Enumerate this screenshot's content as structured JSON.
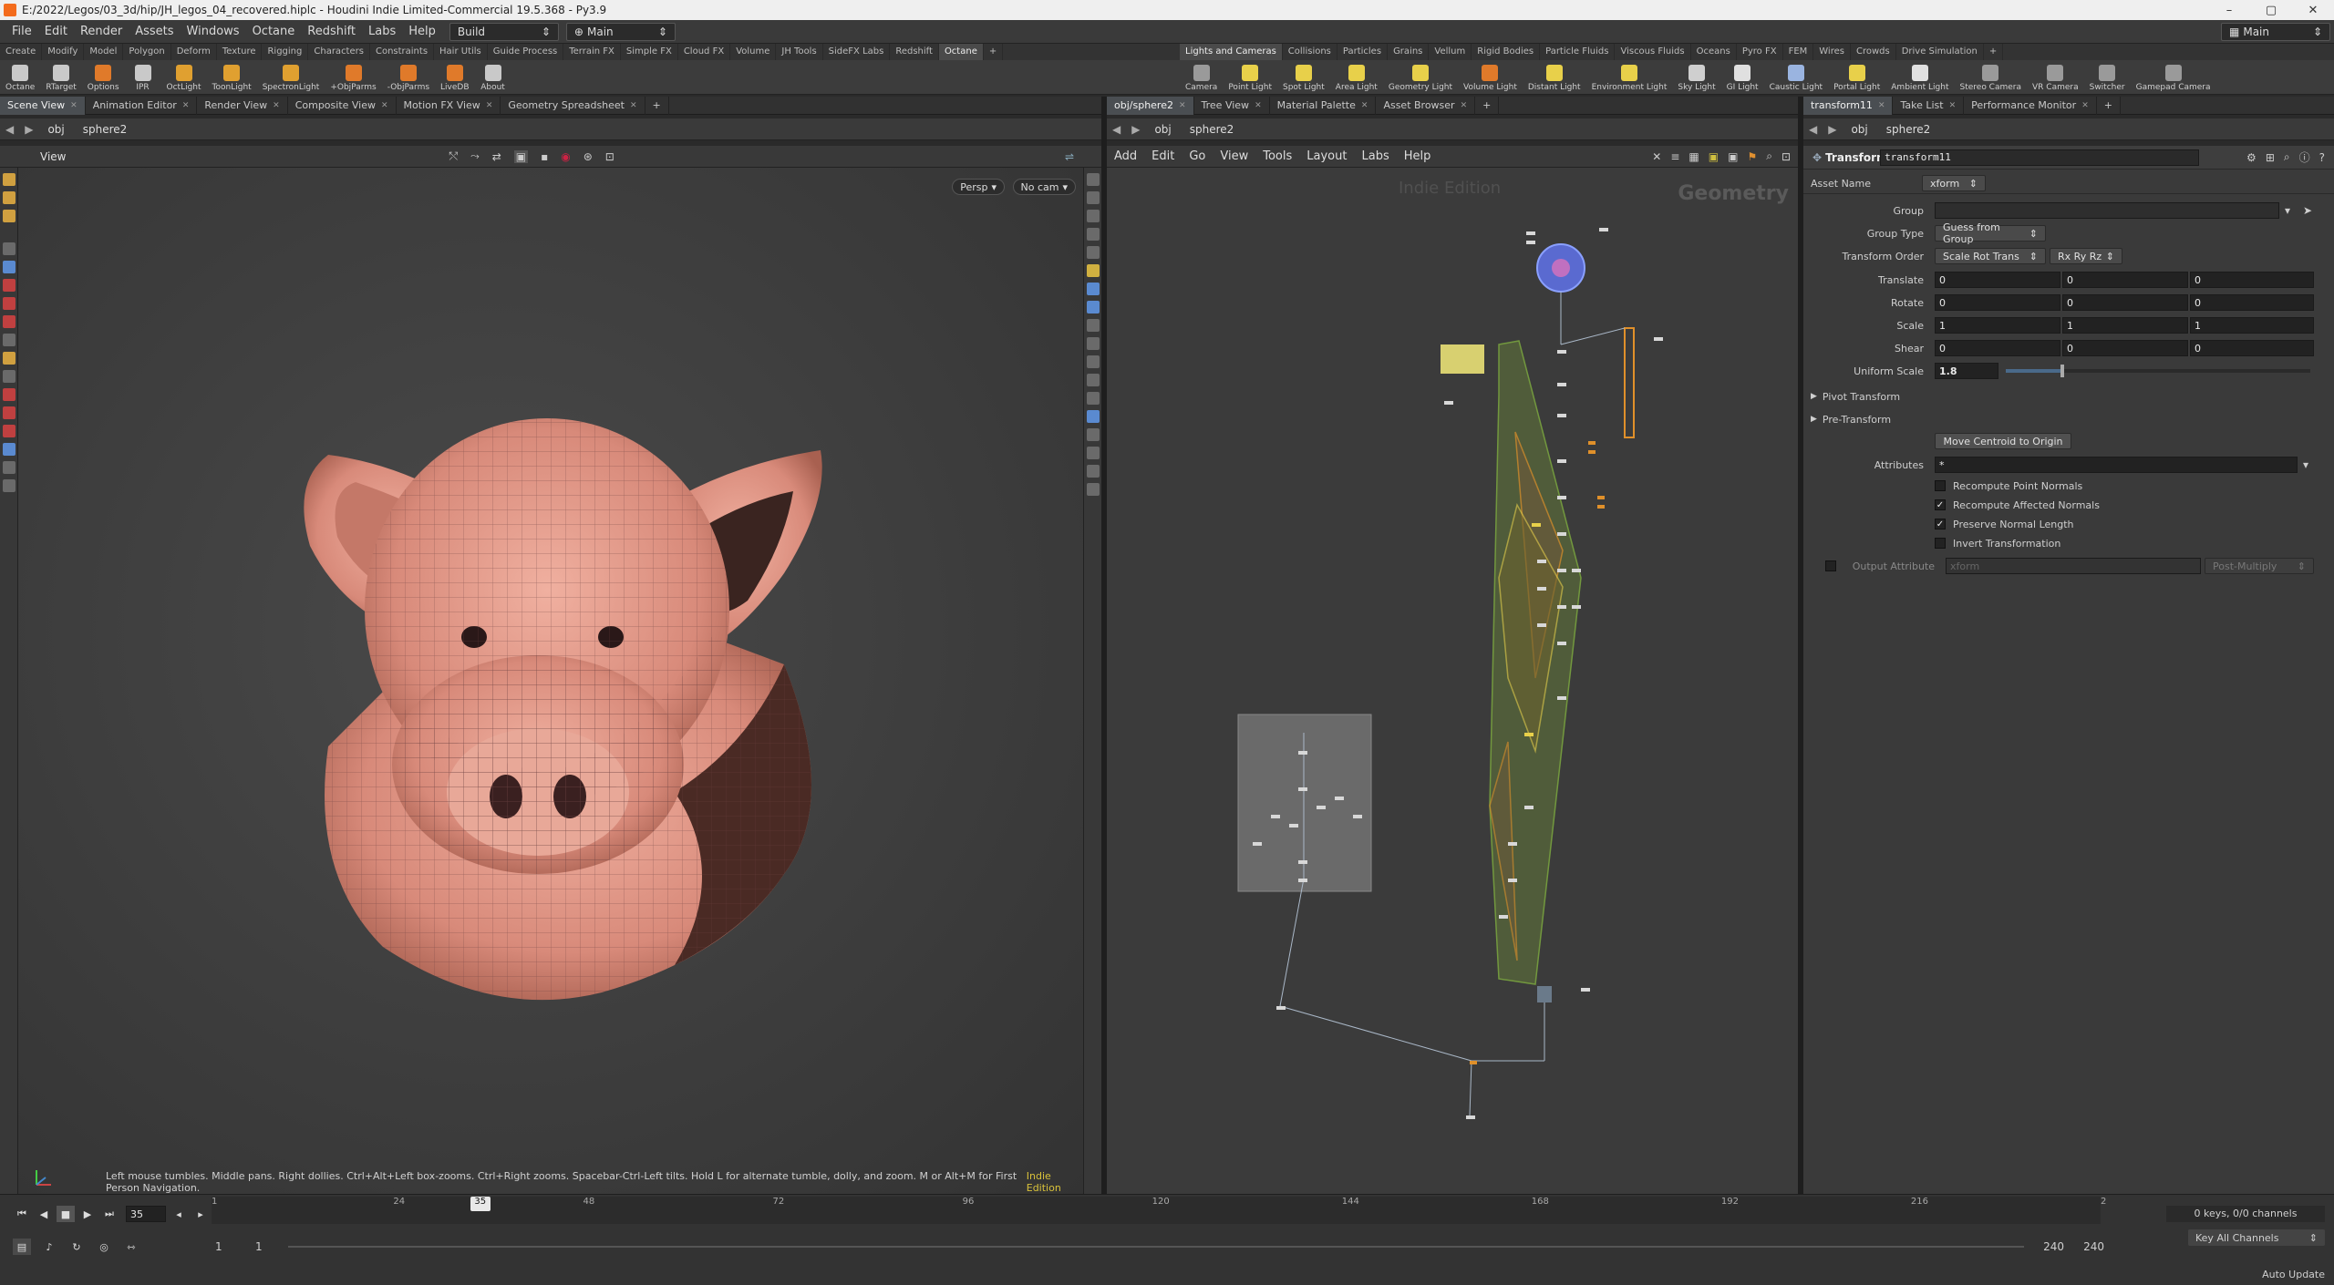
{
  "titlebar": {
    "title": "E:/2022/Legos/03_3d/hip/JH_legos_04_recovered.hiplc - Houdini Indie Limited-Commercial 19.5.368 - Py3.9"
  },
  "menubar": {
    "items": [
      "File",
      "Edit",
      "Render",
      "Assets",
      "Windows",
      "Octane",
      "Redshift",
      "Labs",
      "Help"
    ],
    "desktop": "Build",
    "context": "Main",
    "right_context": "Main"
  },
  "shelf_tabs_left": [
    "Create",
    "Modify",
    "Model",
    "Polygon",
    "Deform",
    "Texture",
    "Rigging",
    "Characters",
    "Constraints",
    "Hair Utils",
    "Guide Process",
    "Terrain FX",
    "Simple FX",
    "Cloud FX",
    "Volume",
    "JH Tools",
    "SideFX Labs",
    "Redshift",
    "Octane"
  ],
  "shelf_tabs_right": [
    "Lights and Cameras",
    "Collisions",
    "Particles",
    "Grains",
    "Vellum",
    "Rigid Bodies",
    "Particle Fluids",
    "Viscous Fluids",
    "Oceans",
    "Pyro FX",
    "FEM",
    "Wires",
    "Crowds",
    "Drive Simulation"
  ],
  "shelf_tools_left": [
    {
      "label": "Octane",
      "color": "#c9c9c9"
    },
    {
      "label": "RTarget",
      "color": "#c9c9c9"
    },
    {
      "label": "Options",
      "color": "#e07a2a"
    },
    {
      "label": "IPR",
      "color": "#c9c9c9"
    },
    {
      "label": "OctLight",
      "color": "#e0a030"
    },
    {
      "label": "ToonLight",
      "color": "#e0a030"
    },
    {
      "label": "SpectronLight",
      "color": "#e0a030"
    },
    {
      "label": "+ObjParms",
      "color": "#e07a2a"
    },
    {
      "label": "-ObjParms",
      "color": "#e07a2a"
    },
    {
      "label": "LiveDB",
      "color": "#e07a2a"
    },
    {
      "label": "About",
      "color": "#c9c9c9"
    }
  ],
  "shelf_tools_right": [
    {
      "label": "Camera",
      "color": "#9a9a9a"
    },
    {
      "label": "Point Light",
      "color": "#e8d04a"
    },
    {
      "label": "Spot Light",
      "color": "#e8d04a"
    },
    {
      "label": "Area Light",
      "color": "#e8d04a"
    },
    {
      "label": "Geometry Light",
      "color": "#e8d04a"
    },
    {
      "label": "Volume Light",
      "color": "#e07a2a"
    },
    {
      "label": "Distant Light",
      "color": "#e8d04a"
    },
    {
      "label": "Environment Light",
      "color": "#e8d04a"
    },
    {
      "label": "Sky Light",
      "color": "#cfcfcf"
    },
    {
      "label": "GI Light",
      "color": "#e0e0e0"
    },
    {
      "label": "Caustic Light",
      "color": "#9ab4e0"
    },
    {
      "label": "Portal Light",
      "color": "#e8d04a"
    },
    {
      "label": "Ambient Light",
      "color": "#e0e0e0"
    },
    {
      "label": "Stereo Camera",
      "color": "#9a9a9a"
    },
    {
      "label": "VR Camera",
      "color": "#9a9a9a"
    },
    {
      "label": "Switcher",
      "color": "#9a9a9a"
    },
    {
      "label": "Gamepad Camera",
      "color": "#9a9a9a"
    }
  ],
  "scene_pane": {
    "tabs": [
      "Scene View",
      "Animation Editor",
      "Render View",
      "Composite View",
      "Motion FX View",
      "Geometry Spreadsheet"
    ],
    "path": [
      "obj",
      "sphere2"
    ],
    "view_label": "View",
    "persp": "Persp",
    "cam": "No cam",
    "hint": "Left mouse tumbles. Middle pans. Right dollies. Ctrl+Alt+Left box-zooms. Ctrl+Right zooms. Spacebar-Ctrl-Left tilts. Hold L for alternate tumble, dolly, and zoom.    M or Alt+M for First Person Navigation.",
    "indie": "Indie Edition"
  },
  "network_pane": {
    "tabs": [
      "obj/sphere2",
      "Tree View",
      "Material Palette",
      "Asset Browser"
    ],
    "path": [
      "obj",
      "sphere2"
    ],
    "menu": [
      "Add",
      "Edit",
      "Go",
      "View",
      "Tools",
      "Layout",
      "Labs",
      "Help"
    ],
    "watermark": "Indie Edition",
    "context_label": "Geometry"
  },
  "parm_pane": {
    "tabs": [
      "transform11",
      "Take List",
      "Performance Monitor"
    ],
    "path": [
      "obj",
      "sphere2"
    ],
    "node_type": "Transform",
    "node_name": "transform11",
    "asset_name_label": "Asset Name",
    "asset_name": "xform",
    "group_label": "Group",
    "group_value": "",
    "group_type_label": "Group Type",
    "group_type": "Guess from Group",
    "xform_order_label": "Transform Order",
    "xform_order": "Scale Rot Trans",
    "rot_order": "Rx Ry Rz",
    "translate_label": "Translate",
    "translate": [
      "0",
      "0",
      "0"
    ],
    "rotate_label": "Rotate",
    "rotate": [
      "0",
      "0",
      "0"
    ],
    "scale_label": "Scale",
    "scale": [
      "1",
      "1",
      "1"
    ],
    "shear_label": "Shear",
    "shear": [
      "0",
      "0",
      "0"
    ],
    "uniform_scale_label": "Uniform Scale",
    "uniform_scale": "1.8",
    "uniform_scale_fraction": 0.18,
    "pivot_transform": "Pivot Transform",
    "pre_transform": "Pre-Transform",
    "move_centroid": "Move Centroid to Origin",
    "attributes_label": "Attributes",
    "attributes": "*",
    "recompute_point": "Recompute Point Normals",
    "recompute_affected": "Recompute Affected Normals",
    "preserve_normal": "Preserve Normal Length",
    "invert": "Invert Transformation",
    "output_attr_label": "Output Attribute",
    "output_attr": "xform",
    "post_multiply": "Post-Multiply",
    "checks": {
      "recompute_point": false,
      "recompute_affected": true,
      "preserve_normal": true,
      "invert": false
    }
  },
  "timeline": {
    "current_frame": "35",
    "ruler_ticks": [
      "1",
      "24",
      "48",
      "72",
      "96",
      "120",
      "144",
      "168",
      "192",
      "216",
      "2"
    ],
    "start": "1",
    "range_start": "1",
    "range_end": "240",
    "end": "240",
    "keys": "0 keys, 0/0 channels",
    "key_all": "Key All Channels",
    "auto_update": "Auto Update"
  },
  "colors": {
    "accent": "#4a6a8a",
    "indie": "#d9c23a",
    "pig": "#e89a8a",
    "network_green": "#8ac040",
    "network_orange": "#e0902a",
    "network_yellow": "#e8d04a"
  }
}
